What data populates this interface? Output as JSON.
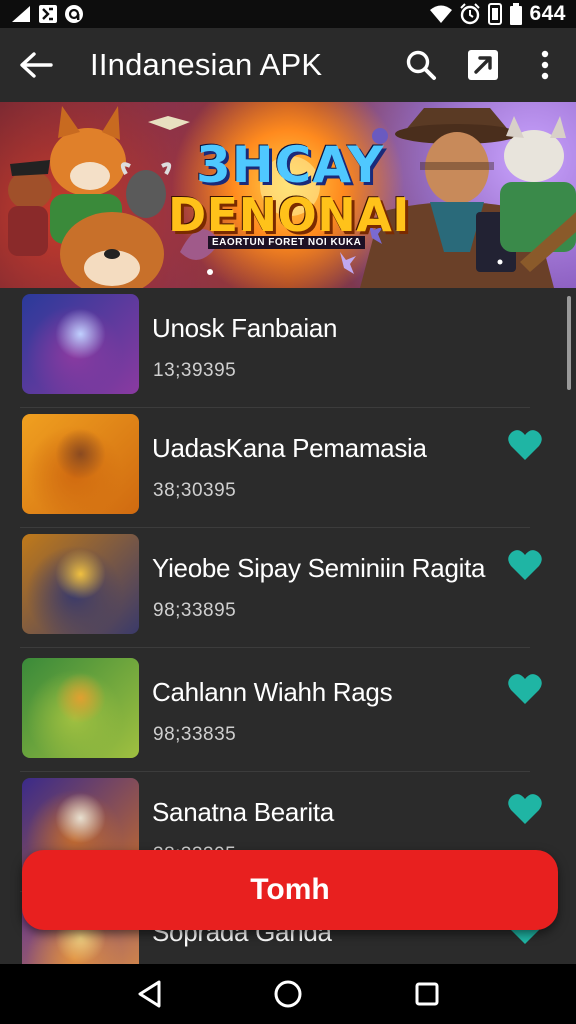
{
  "status_bar": {
    "time": "644"
  },
  "app_bar": {
    "title": "IIndanesian APK"
  },
  "banner": {
    "line1": "3HCAY",
    "line2": "DENONAI",
    "subtitle": "EAORTUN FORET NOI KUKA"
  },
  "apps": [
    {
      "name": "Unosk Fanbaian",
      "count": "13;39395",
      "favorite": false,
      "thumb_colors": [
        "#2a3a9a",
        "#8a3aa0",
        "#c0d0ff"
      ]
    },
    {
      "name": "UadasKana Pemamasia",
      "count": "38;30395",
      "favorite": true,
      "thumb_colors": [
        "#f0a020",
        "#d06a10",
        "#8a4a20"
      ]
    },
    {
      "name": "Yieobe Sipay Seminiin Ragita",
      "count": "98;33895",
      "favorite": true,
      "thumb_colors": [
        "#c07a1a",
        "#3a3a6a",
        "#f0c040"
      ]
    },
    {
      "name": "Cahlann Wiahh Rags",
      "count": "98;33835",
      "favorite": true,
      "thumb_colors": [
        "#3a8a3a",
        "#a0c040",
        "#e0a030"
      ]
    },
    {
      "name": "Sanatna Bearita",
      "count": "38;33395",
      "favorite": true,
      "thumb_colors": [
        "#3a2a8a",
        "#c06a30",
        "#e8e0d0"
      ]
    },
    {
      "name": "Soprada Ganda",
      "count": "",
      "favorite": true,
      "thumb_colors": [
        "#6a3a8a",
        "#e09040",
        "#f0d080"
      ]
    }
  ],
  "primary_button": {
    "label": "Tomh"
  },
  "colors": {
    "accent": "#e8201f",
    "heart": "#1fb5a4",
    "background": "#2b2b2b"
  }
}
